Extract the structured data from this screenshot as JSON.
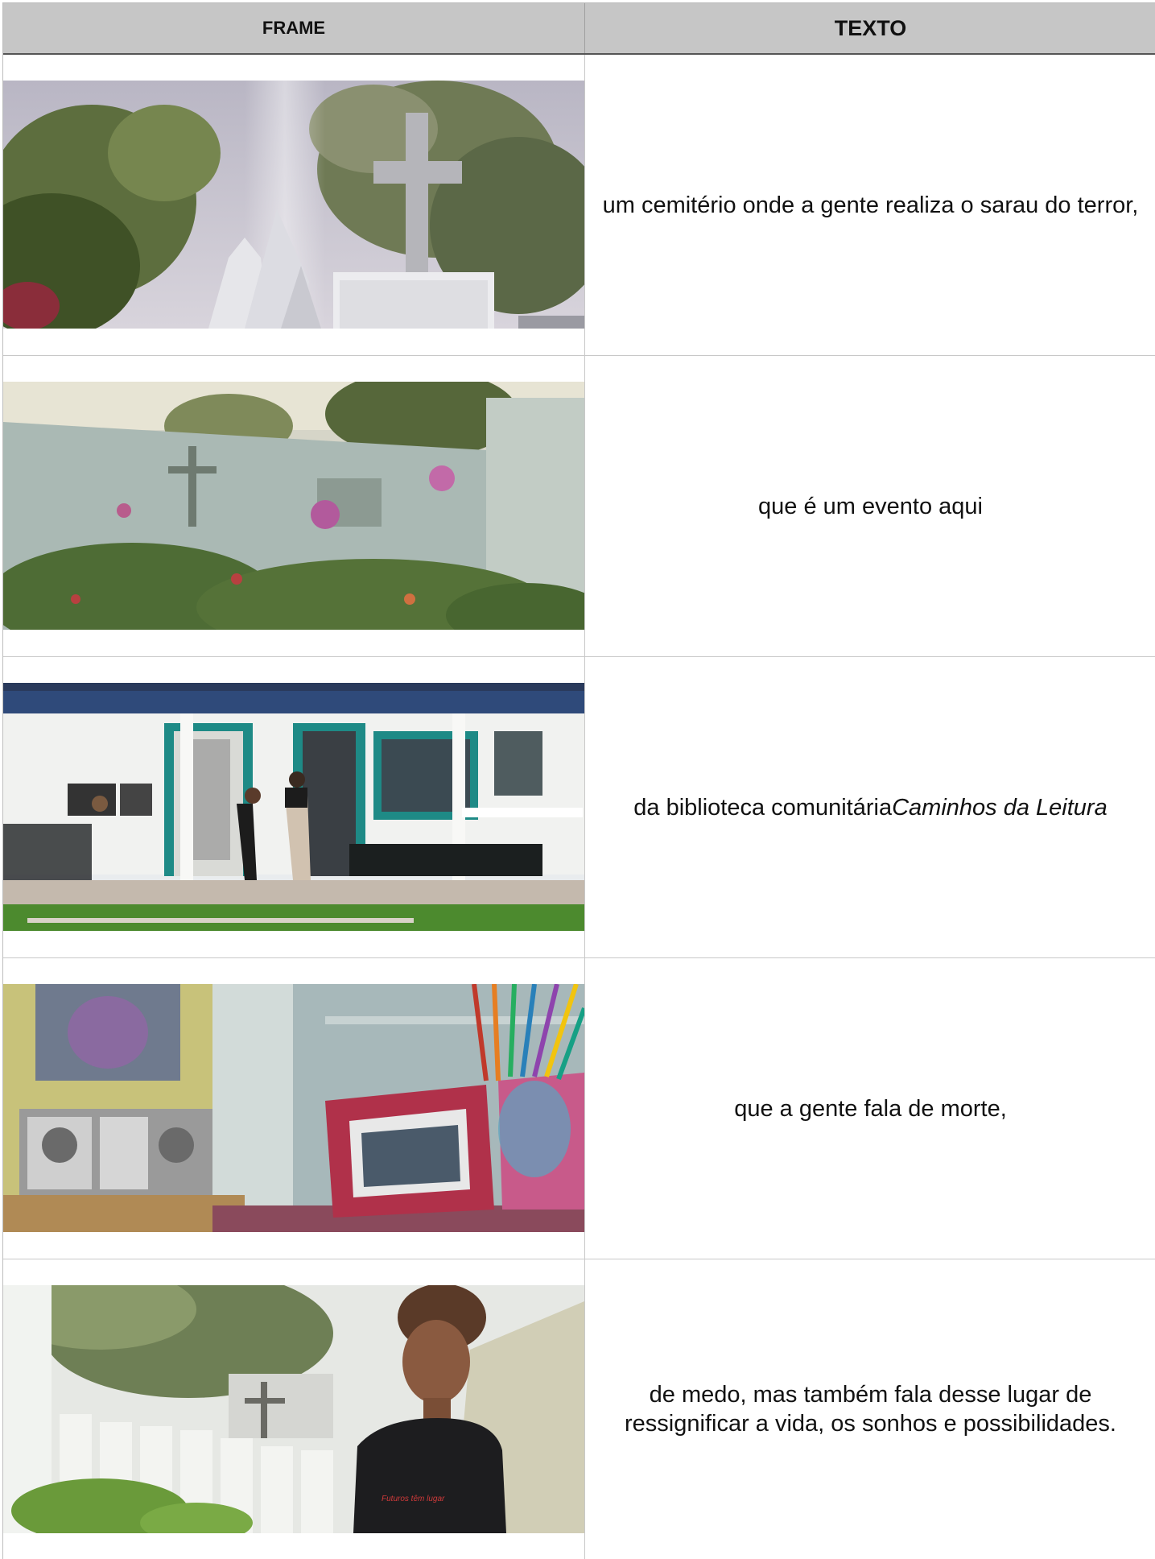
{
  "header": {
    "frame_label": "FRAME",
    "text_label": "TEXTO"
  },
  "rows": [
    {
      "text": "um cemitério onde a gente realiza o sarau do terror,",
      "image": "cemetery-cross"
    },
    {
      "text": "que é um evento aqui",
      "image": "cemetery-wall-flowers"
    },
    {
      "text_pre": "da biblioteca comunitária ",
      "text_em": "Caminhos da Leitura",
      "image": "community-library"
    },
    {
      "text": "que a gente fala de morte,",
      "image": "shelf-pencils-frame"
    },
    {
      "text": "de medo, mas também fala desse lugar de ressignificar a vida, os sonhos e possibilidades.",
      "image": "young-man-cemetery"
    }
  ],
  "shirt_text": "Futuros têm lugar"
}
